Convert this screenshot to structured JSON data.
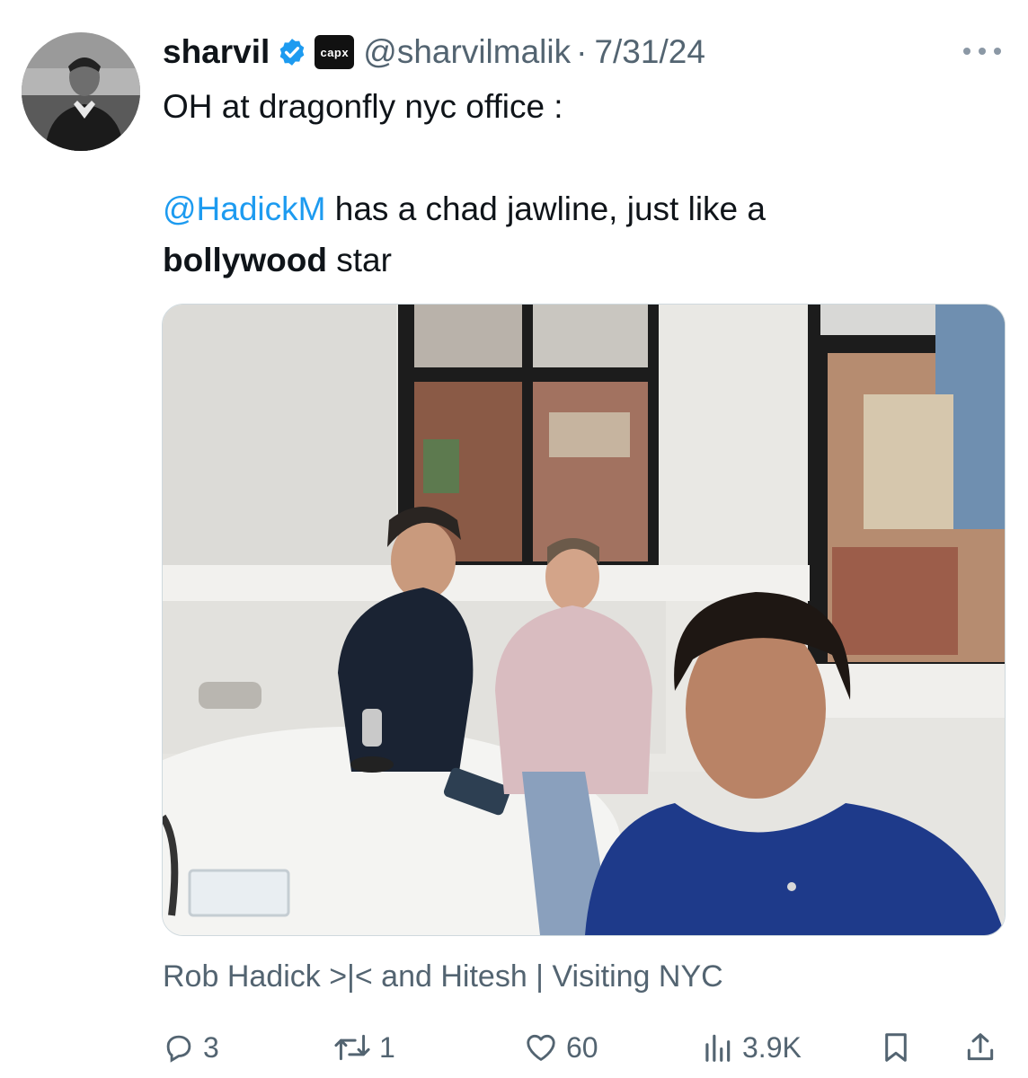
{
  "tweet": {
    "author_name": "sharvil",
    "affiliate_label": "capx",
    "handle": "@sharvilmalik",
    "separator": "·",
    "date": "7/31/24",
    "text_line1": "OH at dragonfly nyc office :",
    "mention": "@HadickM",
    "text_line3_rest": " has a chad jawline, just like a",
    "bold_word": "bollywood",
    "text_line4_rest": " star",
    "media_caption": "Rob Hadick >|< and Hitesh | Visiting NYC"
  },
  "actions": {
    "replies": "3",
    "reposts": "1",
    "likes": "60",
    "views": "3.9K"
  },
  "colors": {
    "accent": "#1d9bf0",
    "muted": "#536471",
    "text": "#0f1419"
  },
  "icons": [
    "verified-badge-icon",
    "more-icon",
    "reply-icon",
    "repost-icon",
    "like-icon",
    "views-icon",
    "bookmark-icon",
    "share-icon"
  ]
}
